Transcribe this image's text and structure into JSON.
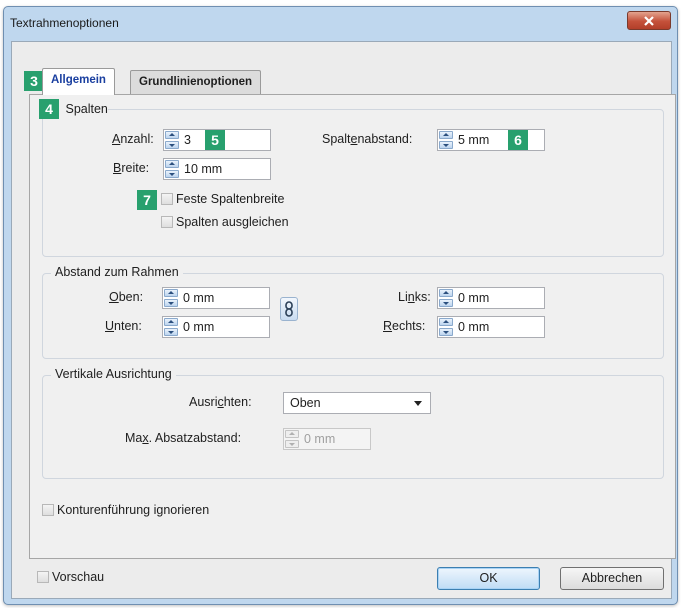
{
  "dialog": {
    "title": "Textrahmenoptionen"
  },
  "tabs": [
    {
      "label": "Allgemein",
      "active": true
    },
    {
      "label": "Grundlinienoptionen",
      "active": false
    }
  ],
  "annotations": {
    "tabs": "3",
    "spalten": "4",
    "anzahl": "5",
    "spaltenabstand": "6",
    "feste": "7"
  },
  "spalten": {
    "title": "Spalten",
    "anzahl": {
      "mnemonic": "A",
      "rest": "nzahl:",
      "value": "3"
    },
    "breite": {
      "mnemonic": "B",
      "rest": "reite:",
      "value": "10 mm"
    },
    "spaltenabstand": {
      "pre": "Spalt",
      "mnemonic": "e",
      "post": "nabstand:",
      "value": "5 mm"
    },
    "feste_spaltenbreite": {
      "label": "Feste Spaltenbreite",
      "checked": false
    },
    "spalten_ausgleichen": {
      "label": "Spalten ausgleichen",
      "checked": false
    }
  },
  "abstand": {
    "title": "Abstand zum Rahmen",
    "oben": {
      "mnemonic": "O",
      "rest": "ben:",
      "value": "0 mm"
    },
    "unten": {
      "mnemonic": "U",
      "rest": "nten:",
      "value": "0 mm"
    },
    "links": {
      "pre": "Li",
      "mnemonic": "n",
      "post": "ks:",
      "value": "0 mm"
    },
    "rechts": {
      "mnemonic": "R",
      "rest": "echts:",
      "value": "0 mm"
    },
    "link_icon": "chain-link-icon"
  },
  "vertikal": {
    "title": "Vertikale Ausrichtung",
    "ausrichten": {
      "pre": "Ausri",
      "mnemonic": "c",
      "post": "hten:",
      "value": "Oben"
    },
    "max_absatzabstand": {
      "pre": "Ma",
      "mnemonic": "x",
      "post": ". Absatzabstand:",
      "value": "0 mm",
      "enabled": false
    }
  },
  "konturenfuehrung": {
    "label": "Konturenführung ignorieren",
    "checked": false
  },
  "footer": {
    "vorschau": {
      "label": "Vorschau",
      "checked": false
    },
    "ok_label": "OK",
    "cancel_label": "Abbrechen"
  },
  "colors": {
    "badge": "#28a06e",
    "close": "#c4513a",
    "frame": "#bfd7ee",
    "active_tab_text": "#1a3fa0"
  }
}
